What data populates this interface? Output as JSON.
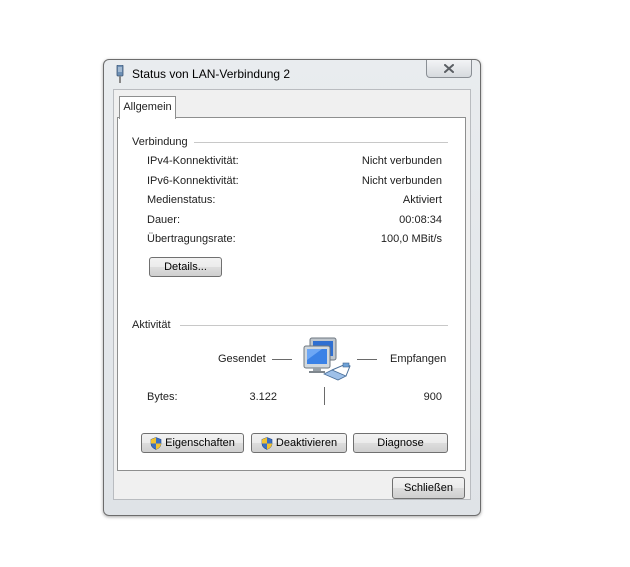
{
  "window": {
    "title": "Status von LAN-Verbindung 2"
  },
  "tabs": [
    {
      "label": "Allgemein",
      "selected": true
    }
  ],
  "connection": {
    "heading": "Verbindung",
    "rows": [
      {
        "label": "IPv4-Konnektivität:",
        "value": "Nicht verbunden"
      },
      {
        "label": "IPv6-Konnektivität:",
        "value": "Nicht verbunden"
      },
      {
        "label": "Medienstatus:",
        "value": "Aktiviert"
      },
      {
        "label": "Dauer:",
        "value": "00:08:34"
      },
      {
        "label": "Übertragungsrate:",
        "value": "100,0 MBit/s"
      }
    ],
    "details_button": "Details..."
  },
  "activity": {
    "heading": "Aktivität",
    "sent_label": "Gesendet",
    "received_label": "Empfangen",
    "bytes_label": "Bytes:",
    "bytes_sent": "3.122",
    "bytes_received": "900",
    "icon": "network-computers-icon"
  },
  "actions": {
    "properties": "Eigenschaften",
    "deactivate": "Deaktivieren",
    "diagnose": "Diagnose"
  },
  "footer": {
    "close": "Schließen"
  },
  "colors": {
    "window_frame": "#dfe3e7",
    "panel_bg": "#ffffff",
    "button_border": "#707070"
  }
}
